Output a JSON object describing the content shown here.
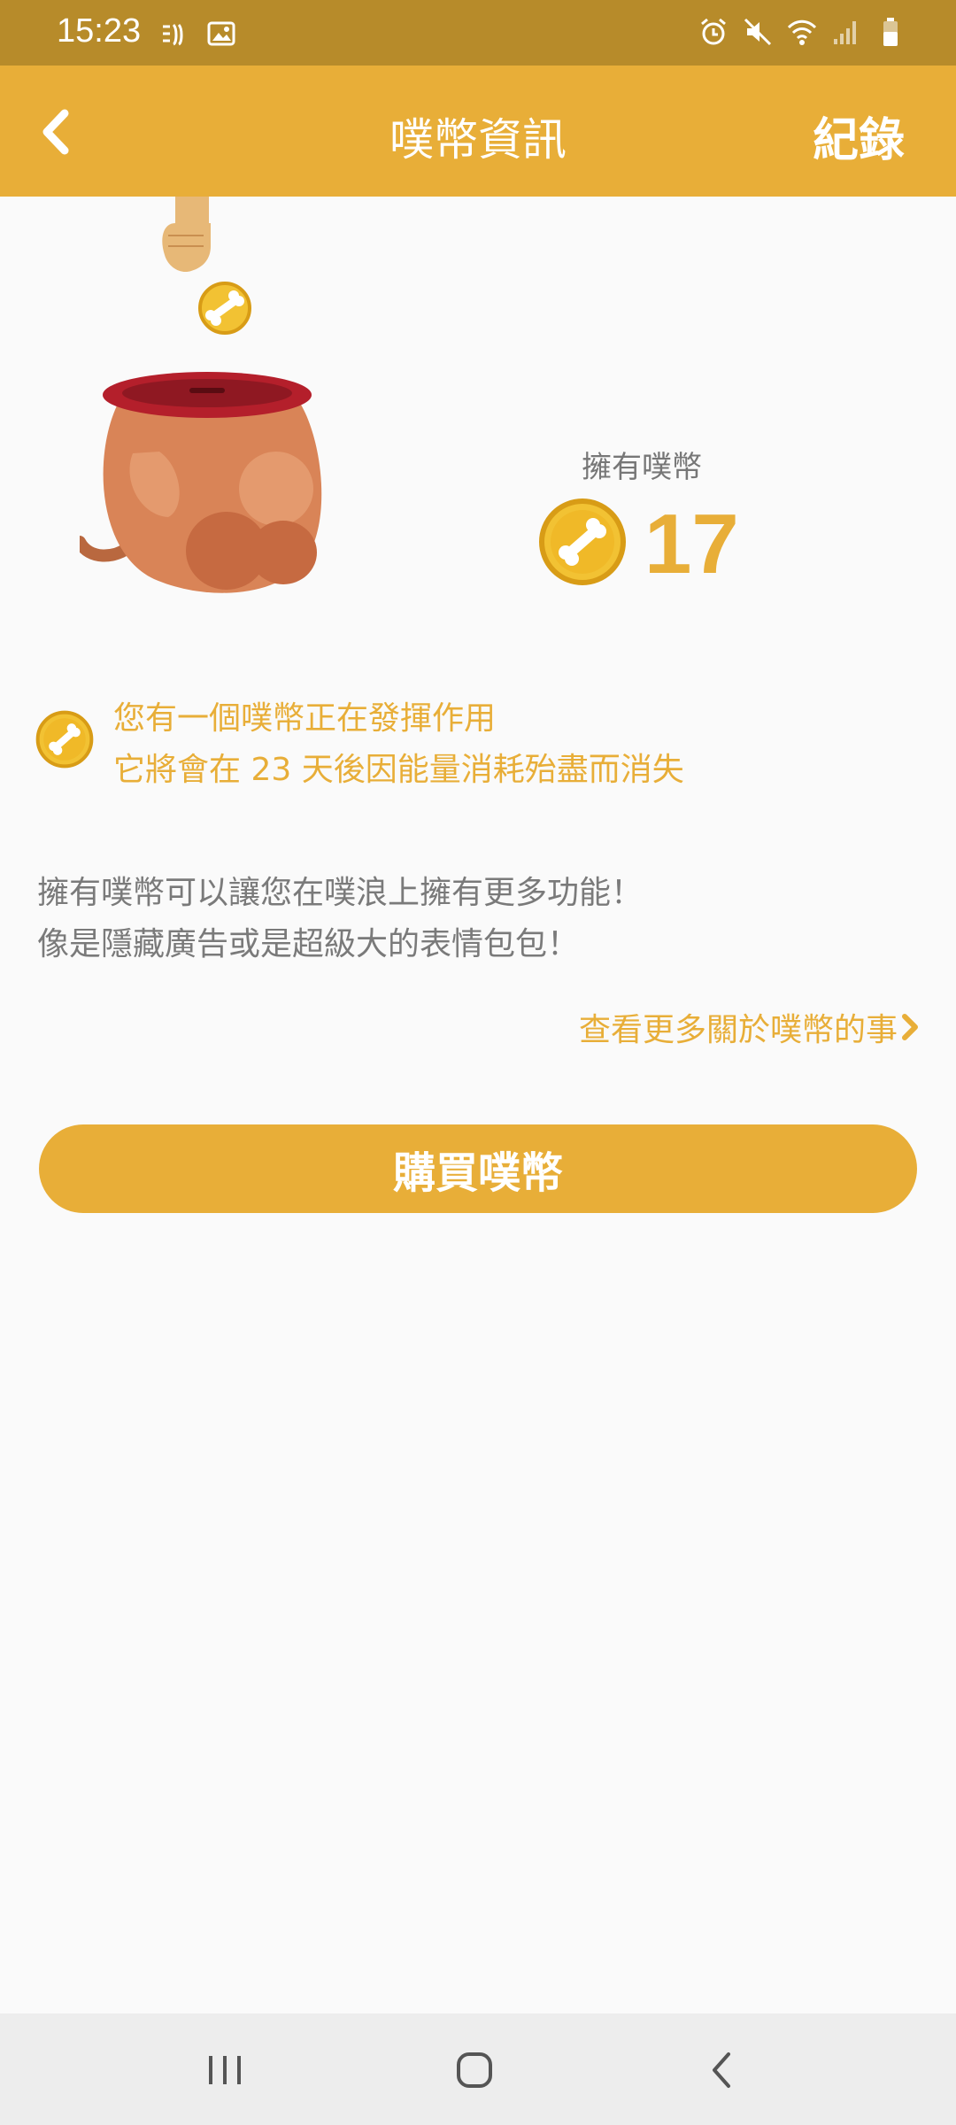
{
  "status_bar": {
    "time": "15:23",
    "left_icons": [
      "notification-icon",
      "gallery-icon"
    ],
    "right_icons": [
      "alarm-icon",
      "mute-icon",
      "wifi-icon",
      "signal-icon",
      "battery-icon"
    ]
  },
  "header": {
    "back_icon": "chevron-left-icon",
    "title": "噗幣資訊",
    "record_label": "紀錄"
  },
  "balance": {
    "label": "擁有噗幣",
    "value": "17"
  },
  "notice": {
    "line1": "您有一個噗幣正在發揮作用",
    "line2": "它將會在 23 天後因能量消耗殆盡而消失"
  },
  "description": {
    "line1": "擁有噗幣可以讓您在噗浪上擁有更多功能！",
    "line2": "像是隱藏廣告或是超級大的表情包包！"
  },
  "more_link": {
    "label": "查看更多關於噗幣的事"
  },
  "buy_button": {
    "label": "購買噗幣"
  },
  "colors": {
    "status_bar": "#b78b2a",
    "accent": "#e8ae38",
    "background": "#fafafa",
    "text_secondary": "#7a7a7a"
  }
}
